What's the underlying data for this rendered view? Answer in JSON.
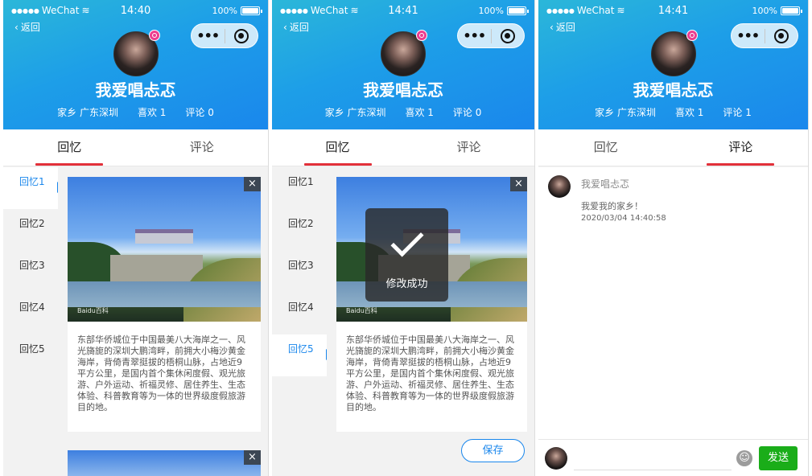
{
  "status_bar": {
    "carrier": "WeChat",
    "battery": "100%"
  },
  "nav": {
    "back_label": "返回"
  },
  "profile": {
    "username": "我爱唱忐忑",
    "hometown": "家乡 广东深圳",
    "likes": "喜欢 1"
  },
  "tabs": {
    "memories": "回忆",
    "comments": "评论"
  },
  "sidebar": {
    "items": [
      "回忆1",
      "回忆2",
      "回忆3",
      "回忆4",
      "回忆5"
    ]
  },
  "memory": {
    "close_icon": "×",
    "watermark": "Baidu百科",
    "description": "东部华侨城位于中国最美八大海岸之一、风光旖旎的深圳大鹏湾畔，前拥大小梅沙黄金海岸，背倚青翠挺拔的梧桐山脉，占地近9平方公里，是国内首个集休闲度假、观光旅游、户外运动、祈福灵修、居住养生、生态体验、科普教育等为一体的世界级度假旅游目的地。"
  },
  "panels": [
    {
      "time": "14:40",
      "comments_stat": "评论 0"
    },
    {
      "time": "14:41",
      "comments_stat": "评论 0",
      "toast": "修改成功",
      "save_label": "保存"
    },
    {
      "time": "14:41",
      "comments_stat": "评论 1"
    }
  ],
  "comment": {
    "author": "我爱唱忐忑",
    "text": "我爱我的家乡！",
    "time": "2020/03/04 14:40:58"
  },
  "comment_bar": {
    "emoji_icon": "☺",
    "send_label": "发送"
  },
  "colors": {
    "header_start": "#2bb7d9",
    "header_end": "#1a87ec",
    "accent": "#1a87ec",
    "tab_indicator": "#e2303a",
    "send": "#1aad19"
  }
}
